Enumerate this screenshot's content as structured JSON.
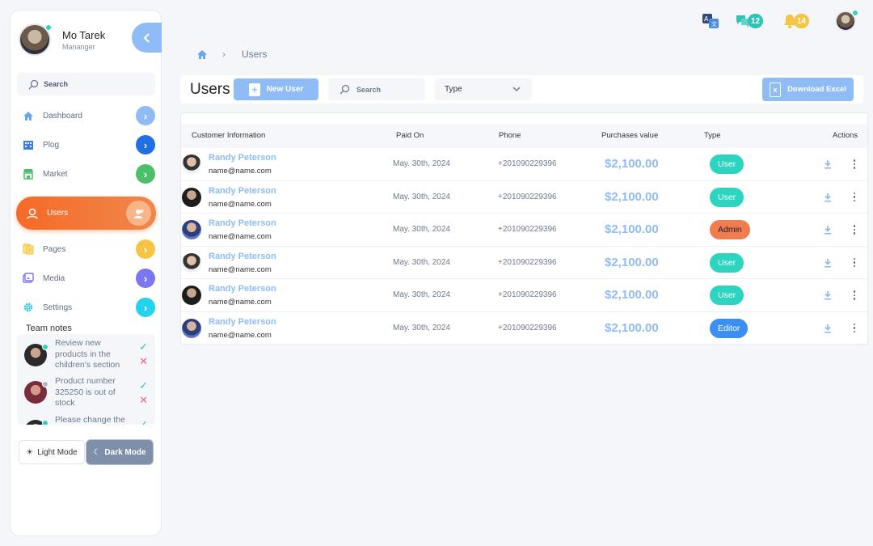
{
  "profile": {
    "name": "Mo Tarek",
    "role": "Mananger"
  },
  "sidebar": {
    "search_label": "Search",
    "items": [
      {
        "label": "Dashboard",
        "chev_color": "#8fbcf5"
      },
      {
        "label": "Plog",
        "chev_color": "#1f6fe5"
      },
      {
        "label": "Market",
        "chev_color": "#4cbf6a"
      },
      {
        "label": "Users",
        "active": true
      },
      {
        "label": "Pages",
        "chev_color": "#f7c443"
      },
      {
        "label": "Media",
        "chev_color": "#7c77f0"
      },
      {
        "label": "Settings",
        "chev_color": "#22d3ee"
      }
    ],
    "team_notes_title": "Team notes",
    "notes": [
      {
        "text": "Review new products in the children's section"
      },
      {
        "text": "Product number 325250 is out of stock"
      },
      {
        "text": "Please change the"
      }
    ],
    "light_mode": "Light Mode",
    "dark_mode": "Dark Mode"
  },
  "topbar": {
    "messages_count": "12",
    "notifications_count": "14"
  },
  "breadcrumb": {
    "current": "Users"
  },
  "header": {
    "title": "Users",
    "new_user": "New User",
    "search_placeholder": "Search",
    "type_select": "Type",
    "download_excel": "Download Excel"
  },
  "table": {
    "columns": [
      "Customer Information",
      "Paid On",
      "Phone",
      "Purchases value",
      "Type",
      "Actions"
    ],
    "rows": [
      {
        "name": "Randy Peterson",
        "email": "name@name.com",
        "paid_on": "May. 30th, 2024",
        "phone": "+201090229396",
        "value": "$2,100.00",
        "type": "User"
      },
      {
        "name": "Randy Peterson",
        "email": "name@name.com",
        "paid_on": "May. 30th, 2024",
        "phone": "+201090229396",
        "value": "$2,100.00",
        "type": "User"
      },
      {
        "name": "Randy Peterson",
        "email": "name@name.com",
        "paid_on": "May. 30th, 2024",
        "phone": "+201090229396",
        "value": "$2,100.00",
        "type": "Admin"
      },
      {
        "name": "Randy Peterson",
        "email": "name@name.com",
        "paid_on": "May. 30th, 2024",
        "phone": "+201090229396",
        "value": "$2,100.00",
        "type": "User"
      },
      {
        "name": "Randy Peterson",
        "email": "name@name.com",
        "paid_on": "May. 30th, 2024",
        "phone": "+201090229396",
        "value": "$2,100.00",
        "type": "User"
      },
      {
        "name": "Randy Peterson",
        "email": "name@name.com",
        "paid_on": "May. 30th, 2024",
        "phone": "+201090229396",
        "value": "$2,100.00",
        "type": "Editor"
      }
    ]
  },
  "colors": {
    "accent": "#8fbcf5",
    "active_nav": "#f56a28",
    "type_user": "#2dd4bf",
    "type_admin": "#f07d4f",
    "type_editor": "#3b8ff0"
  }
}
